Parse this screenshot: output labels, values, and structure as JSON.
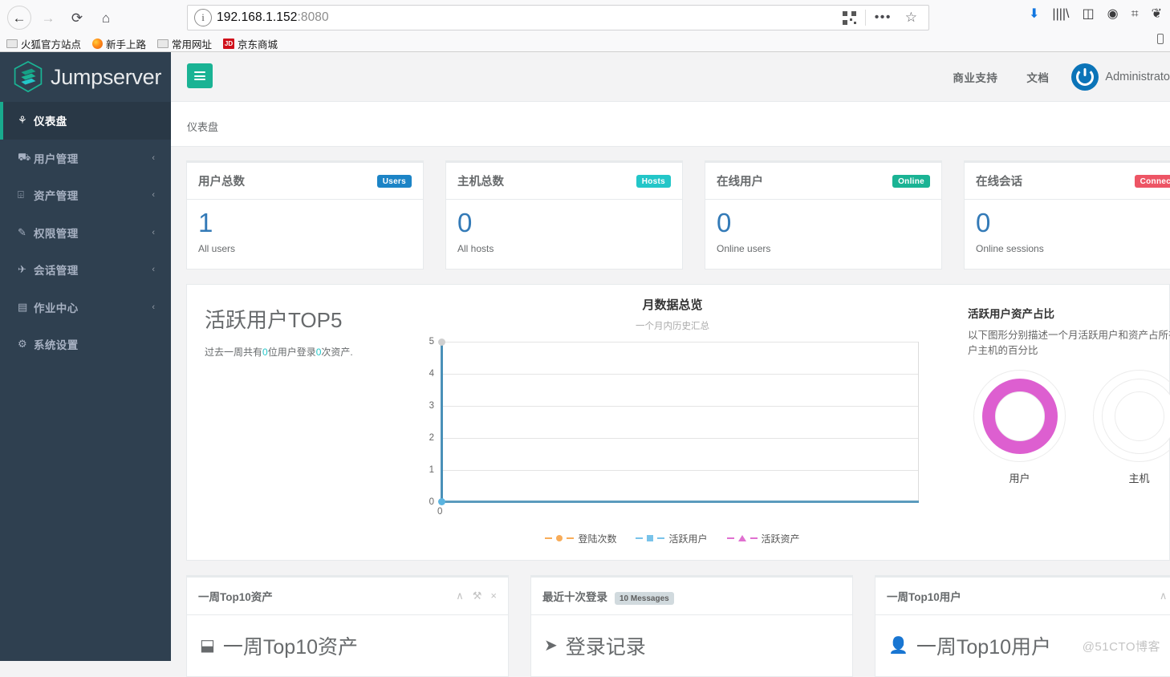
{
  "browser": {
    "url_host": "192.168.1.152",
    "url_port": ":8080",
    "back_icon": "←",
    "forward_icon": "→",
    "reload_icon": "⟳",
    "home_icon": "⌂",
    "info_icon": "i",
    "dots_icon": "•••",
    "star_icon": "☆",
    "download_icon": "⬇",
    "library_icon": "||||\\",
    "sidebar_icon": "◫",
    "account_icon": "◉",
    "screenshot_icon": "⌗",
    "pocket_icon": "❦",
    "bookmarks": [
      {
        "label": "火狐官方站点",
        "icon": "folder-icon"
      },
      {
        "label": "新手上路",
        "icon": "firefox-icon"
      },
      {
        "label": "常用网址",
        "icon": "folder-icon"
      },
      {
        "label": "京东商城",
        "icon": "jd-icon"
      }
    ]
  },
  "sidebar": {
    "brand": "Jumpserver",
    "items": [
      {
        "label": "仪表盘",
        "icon": "dashboard-icon",
        "glyph": "⚘",
        "active": true,
        "caret": ""
      },
      {
        "label": "用户管理",
        "icon": "users-icon",
        "glyph": "⛟",
        "active": false,
        "caret": "‹"
      },
      {
        "label": "资产管理",
        "icon": "assets-icon",
        "glyph": "⌹",
        "active": false,
        "caret": "‹"
      },
      {
        "label": "权限管理",
        "icon": "permissions-icon",
        "glyph": "✎",
        "active": false,
        "caret": "‹"
      },
      {
        "label": "会话管理",
        "icon": "sessions-icon",
        "glyph": "✈",
        "active": false,
        "caret": "‹"
      },
      {
        "label": "作业中心",
        "icon": "jobs-icon",
        "glyph": "▤",
        "active": false,
        "caret": "‹"
      },
      {
        "label": "系统设置",
        "icon": "settings-icon",
        "glyph": "⚙",
        "active": false,
        "caret": ""
      }
    ]
  },
  "header": {
    "menu_toggle_icon": "hamburger-icon",
    "links": [
      {
        "label": "商业支持"
      },
      {
        "label": "文档"
      }
    ],
    "user_name": "Administrato"
  },
  "breadcrumb": {
    "current": "仪表盘"
  },
  "stats": [
    {
      "title": "用户总数",
      "badge": "Users",
      "badge_color": "#1c84c6",
      "value": "1",
      "sub": "All users"
    },
    {
      "title": "主机总数",
      "badge": "Hosts",
      "badge_color": "#23c6c8",
      "value": "0",
      "sub": "All hosts"
    },
    {
      "title": "在线用户",
      "badge": "Online",
      "badge_color": "#1ab394",
      "value": "0",
      "sub": "Online users"
    },
    {
      "title": "在线会话",
      "badge": "Connected",
      "badge_color": "#ed5565",
      "value": "0",
      "sub": "Online sessions"
    }
  ],
  "top5": {
    "title": "活跃用户TOP5",
    "desc_before": "过去一周共有",
    "desc_n1": "0",
    "desc_mid": "位用户登录",
    "desc_n2": "0",
    "desc_after": "次资产."
  },
  "chart_data": {
    "type": "line",
    "title": "月数据总览",
    "subtitle": "一个月内历史汇总",
    "xlabel": "",
    "ylabel": "",
    "ylim": [
      0,
      5
    ],
    "yticks": [
      0,
      1,
      2,
      3,
      4,
      5
    ],
    "xticks": [
      "0"
    ],
    "x": [
      0
    ],
    "grid": true,
    "legend_position": "bottom",
    "series": [
      {
        "name": "登陆次数",
        "values": [
          0
        ],
        "color": "#f8ac59",
        "marker": "circle"
      },
      {
        "name": "活跃用户",
        "values": [
          0
        ],
        "color": "#79c3ea",
        "marker": "square"
      },
      {
        "name": "活跃资产",
        "values": [
          0
        ],
        "color": "#e070d0",
        "marker": "triangle"
      }
    ]
  },
  "donut_section": {
    "title": "活跃用户资产占比",
    "desc": "以下图形分别描述一个月活跃用户和资产占所有用户主机的百分比",
    "charts": [
      {
        "label": "用户",
        "percent": 100,
        "color": "#dd5fd0"
      },
      {
        "label": "主机",
        "percent": 0,
        "color": "#dd5fd0"
      }
    ]
  },
  "boxes": [
    {
      "title": "一周Top10资产",
      "badge": "",
      "body_title": "一周Top10资产",
      "body_icon": "inbox-icon",
      "body_glyph": "⬓",
      "tools": [
        "collapse-icon",
        "wrench-icon",
        "close-icon"
      ],
      "tool_glyphs": [
        "∧",
        "⚒",
        "×"
      ]
    },
    {
      "title": "最近十次登录",
      "badge": "10 Messages",
      "body_title": "登录记录",
      "body_icon": "paper-plane-icon",
      "body_glyph": "➤",
      "tools": [],
      "tool_glyphs": []
    },
    {
      "title": "一周Top10用户",
      "badge": "",
      "body_title": "一周Top10用户",
      "body_icon": "user-icon",
      "body_glyph": "👤",
      "tools": [
        "collapse-icon",
        "wrench-icon"
      ],
      "tool_glyphs": [
        "∧",
        "⚒"
      ]
    }
  ],
  "watermark": "@51CTO博客"
}
